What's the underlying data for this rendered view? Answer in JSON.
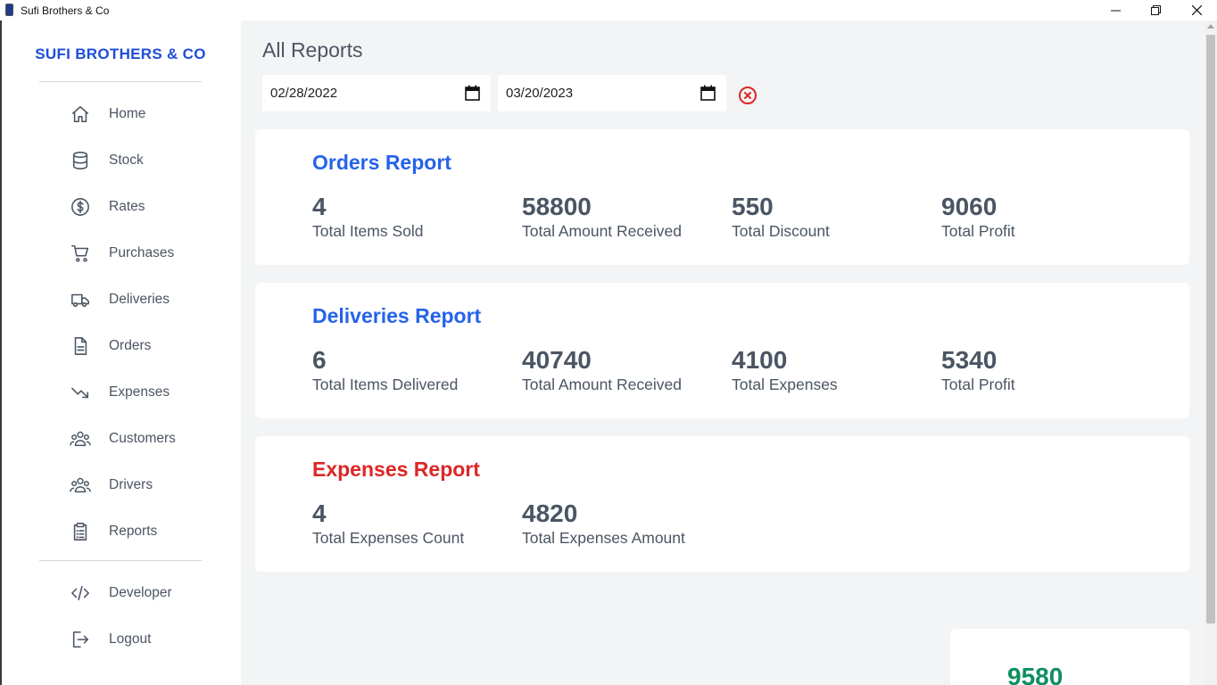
{
  "window": {
    "title": "Sufi Brothers & Co"
  },
  "sidebar": {
    "brand": "SUFI BROTHERS & CO",
    "items": [
      {
        "label": "Home",
        "icon": "home-icon"
      },
      {
        "label": "Stock",
        "icon": "database-icon"
      },
      {
        "label": "Rates",
        "icon": "dollar-circle-icon"
      },
      {
        "label": "Purchases",
        "icon": "cart-icon"
      },
      {
        "label": "Deliveries",
        "icon": "truck-icon"
      },
      {
        "label": "Orders",
        "icon": "document-icon"
      },
      {
        "label": "Expenses",
        "icon": "trending-down-icon"
      },
      {
        "label": "Customers",
        "icon": "user-group-icon"
      },
      {
        "label": "Drivers",
        "icon": "user-group-icon"
      },
      {
        "label": "Reports",
        "icon": "clipboard-list-icon"
      }
    ],
    "bottom_items": [
      {
        "label": "Developer",
        "icon": "code-icon"
      },
      {
        "label": "Logout",
        "icon": "logout-icon"
      }
    ]
  },
  "main": {
    "title": "All Reports",
    "date_from": "02/28/2022",
    "date_to": "03/20/2023",
    "orders_report": {
      "title": "Orders Report",
      "stats": [
        {
          "value": "4",
          "label": "Total Items Sold"
        },
        {
          "value": "58800",
          "label": "Total Amount Received"
        },
        {
          "value": "550",
          "label": "Total Discount"
        },
        {
          "value": "9060",
          "label": "Total Profit"
        }
      ]
    },
    "deliveries_report": {
      "title": "Deliveries Report",
      "stats": [
        {
          "value": "6",
          "label": "Total Items Delivered"
        },
        {
          "value": "40740",
          "label": "Total Amount Received"
        },
        {
          "value": "4100",
          "label": "Total Expenses"
        },
        {
          "value": "5340",
          "label": "Total Profit"
        }
      ]
    },
    "expenses_report": {
      "title": "Expenses Report",
      "stats": [
        {
          "value": "4",
          "label": "Total Expenses Count"
        },
        {
          "value": "4820",
          "label": "Total Expenses Amount"
        }
      ]
    },
    "summary": {
      "value": "9580"
    }
  },
  "colors": {
    "brand": "#1d4ed8",
    "report_title": "#2563eb",
    "expenses_title": "#dc2626",
    "summary_value": "#0e8f60",
    "clear_icon": "#dc2626"
  }
}
